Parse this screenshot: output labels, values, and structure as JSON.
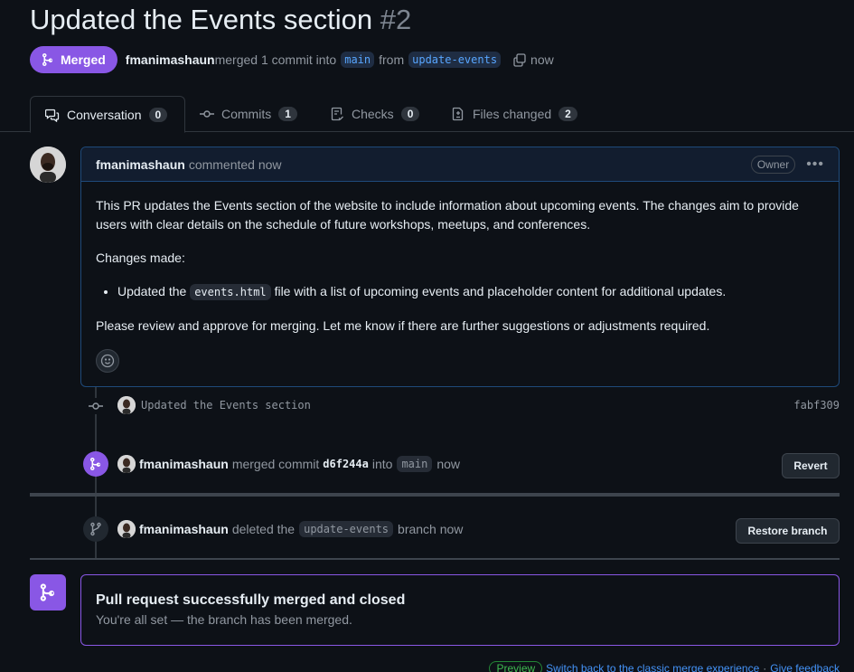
{
  "pr": {
    "title": "Updated the Events section",
    "number": "#2",
    "status_label": "Merged",
    "author": "fmanimashaun",
    "merge_text": "merged 1 commit into",
    "base_branch": "main",
    "from_text": "from",
    "head_branch": "update-events",
    "time": "now"
  },
  "tabs": [
    {
      "label": "Conversation",
      "count": "0"
    },
    {
      "label": "Commits",
      "count": "1"
    },
    {
      "label": "Checks",
      "count": "0"
    },
    {
      "label": "Files changed",
      "count": "2"
    }
  ],
  "comment": {
    "author": "fmanimashaun",
    "action": "commented now",
    "role": "Owner",
    "p1": "This PR updates the Events section of the website to include information about upcoming events. The changes aim to provide users with clear details on the schedule of future workshops, meetups, and conferences.",
    "p2": "Changes made:",
    "li_before": "Updated the",
    "li_code": "events.html",
    "li_after": "file with a list of upcoming events and placeholder content for additional updates.",
    "p3": "Please review and approve for merging. Let me know if there are further suggestions or adjustments required."
  },
  "timeline": {
    "commit_message": "Updated the Events section",
    "commit_sha": "fabf309",
    "merge_user": "fmanimashaun",
    "merge_text": "merged commit",
    "merge_sha": "d6f244a",
    "merge_into": "into",
    "merge_branch": "main",
    "merge_time": "now",
    "revert_label": "Revert",
    "delete_user": "fmanimashaun",
    "delete_text": "deleted the",
    "delete_branch": "update-events",
    "delete_suffix": "branch now",
    "restore_label": "Restore branch"
  },
  "merged_box": {
    "heading": "Pull request successfully merged and closed",
    "subtext": "You're all set — the branch has been merged."
  },
  "footer": {
    "preview_label": "Preview",
    "switch_link": "Switch back to the classic merge experience",
    "separator": "·",
    "feedback_link": "Give feedback"
  },
  "colors": {
    "merged_purple": "#8957e5",
    "link_blue": "#4493f8",
    "background": "#0d1117"
  }
}
